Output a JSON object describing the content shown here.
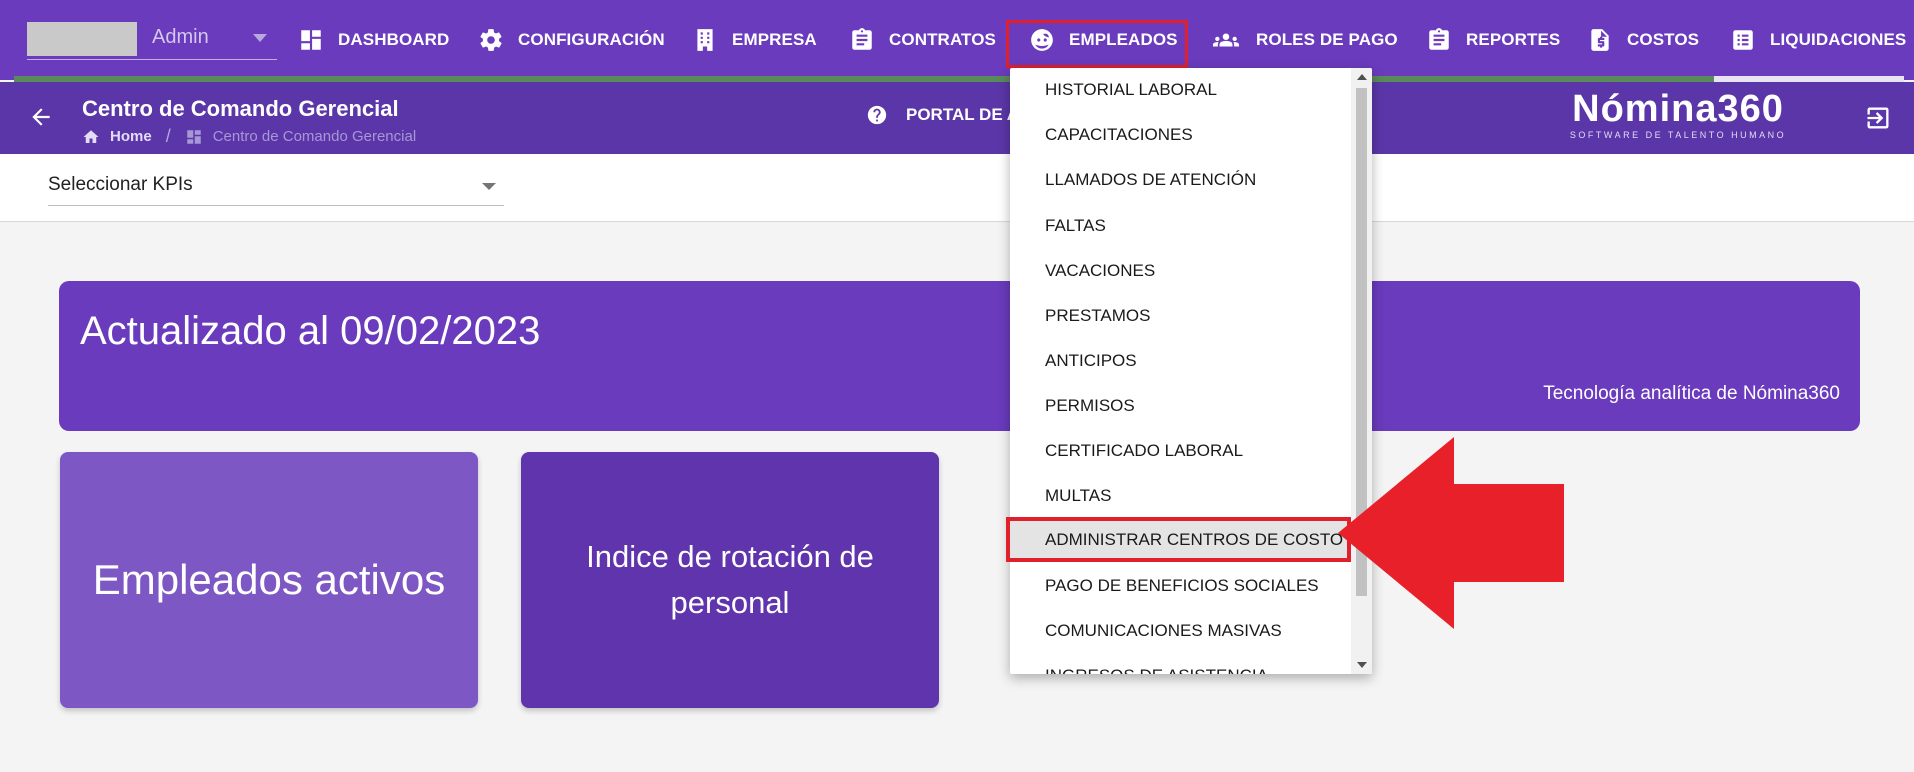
{
  "topnav": {
    "user_label": "Admin",
    "items": [
      {
        "label": "DASHBOARD",
        "icon": "dashboard-icon"
      },
      {
        "label": "CONFIGURACIÓN",
        "icon": "gear-icon"
      },
      {
        "label": "EMPRESA",
        "icon": "building-icon"
      },
      {
        "label": "CONTRATOS",
        "icon": "clipboard-icon"
      },
      {
        "label": "EMPLEADOS",
        "icon": "face-icon"
      },
      {
        "label": "ROLES DE PAGO",
        "icon": "people-icon"
      },
      {
        "label": "REPORTES",
        "icon": "clipboard-icon"
      },
      {
        "label": "COSTOS",
        "icon": "invoice-icon"
      },
      {
        "label": "LIQUIDACIONES",
        "icon": "list-icon"
      }
    ],
    "active_item": "EMPLEADOS"
  },
  "subheader": {
    "title": "Centro de Comando Gerencial",
    "breadcrumb_home": "Home",
    "breadcrumb_separator": "/",
    "breadcrumb_current": "Centro de Comando Gerencial",
    "portal_label": "PORTAL DE A",
    "logo_main": "Nómina360",
    "logo_sub": "SOFTWARE DE TALENTO HUMANO"
  },
  "filter": {
    "kpi_select_value": "Seleccionar KPIs"
  },
  "banner": {
    "title": "Actualizado al 09/02/2023",
    "subtitle": "Tecnología analítica de Nómina360"
  },
  "cards": [
    {
      "label": "Empleados activos"
    },
    {
      "label": "Indice de rotación de personal"
    }
  ],
  "dropdown": {
    "items": [
      "HISTORIAL LABORAL",
      "CAPACITACIONES",
      "LLAMADOS DE ATENCIÓN",
      "FALTAS",
      "VACACIONES",
      "PRESTAMOS",
      "ANTICIPOS",
      "PERMISOS",
      "CERTIFICADO LABORAL",
      "MULTAS",
      "ADMINISTRAR CENTROS DE COSTO",
      "PAGO DE BENEFICIOS SOCIALES",
      "COMUNICACIONES MASIVAS",
      "INGRESOS DE ASISTENCIA"
    ],
    "selected": "ADMINISTRAR CENTROS DE COSTO"
  },
  "colors": {
    "primary": "#6a3bbd",
    "subheader": "#5b36a8",
    "highlight": "#e0202a"
  }
}
